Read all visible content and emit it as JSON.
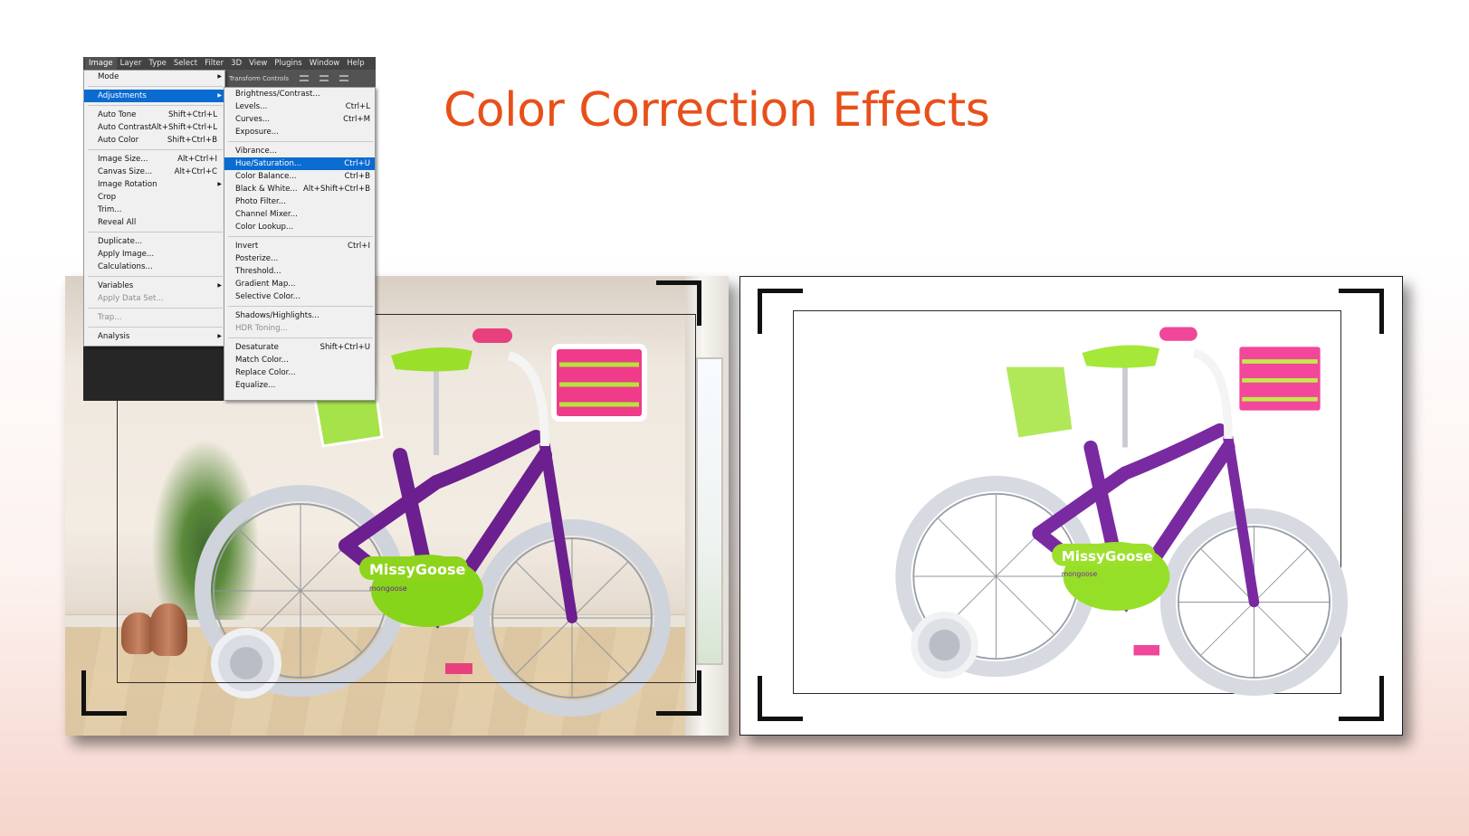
{
  "page": {
    "title": "Color Correction Effects",
    "accent_color": "#e8501a"
  },
  "photoshop": {
    "menubar": [
      "Image",
      "Layer",
      "Type",
      "Select",
      "Filter",
      "3D",
      "View",
      "Plugins",
      "Window",
      "Help"
    ],
    "active_menu": "Image",
    "options_bar_label": "Transform Controls",
    "image_menu": {
      "mode": {
        "label": "Mode",
        "submenu": true
      },
      "adjustments": {
        "label": "Adjustments",
        "submenu": true,
        "highlighted": true
      },
      "auto_tone": {
        "label": "Auto Tone",
        "shortcut": "Shift+Ctrl+L"
      },
      "auto_contrast": {
        "label": "Auto Contrast",
        "shortcut": "Alt+Shift+Ctrl+L"
      },
      "auto_color": {
        "label": "Auto Color",
        "shortcut": "Shift+Ctrl+B"
      },
      "image_size": {
        "label": "Image Size...",
        "shortcut": "Alt+Ctrl+I"
      },
      "canvas_size": {
        "label": "Canvas Size...",
        "shortcut": "Alt+Ctrl+C"
      },
      "image_rotation": {
        "label": "Image Rotation",
        "submenu": true
      },
      "crop": {
        "label": "Crop"
      },
      "trim": {
        "label": "Trim..."
      },
      "reveal_all": {
        "label": "Reveal All"
      },
      "duplicate": {
        "label": "Duplicate..."
      },
      "apply_image": {
        "label": "Apply Image..."
      },
      "calculations": {
        "label": "Calculations..."
      },
      "variables": {
        "label": "Variables",
        "submenu": true
      },
      "apply_data_set": {
        "label": "Apply Data Set...",
        "disabled": true
      },
      "trap": {
        "label": "Trap...",
        "disabled": true
      },
      "analysis": {
        "label": "Analysis",
        "submenu": true
      }
    },
    "adjustments_menu": {
      "brightness_contrast": {
        "label": "Brightness/Contrast..."
      },
      "levels": {
        "label": "Levels...",
        "shortcut": "Ctrl+L"
      },
      "curves": {
        "label": "Curves...",
        "shortcut": "Ctrl+M"
      },
      "exposure": {
        "label": "Exposure..."
      },
      "vibrance": {
        "label": "Vibrance..."
      },
      "hue_saturation": {
        "label": "Hue/Saturation...",
        "shortcut": "Ctrl+U",
        "highlighted": true
      },
      "color_balance": {
        "label": "Color Balance...",
        "shortcut": "Ctrl+B"
      },
      "black_white": {
        "label": "Black & White...",
        "shortcut": "Alt+Shift+Ctrl+B"
      },
      "photo_filter": {
        "label": "Photo Filter..."
      },
      "channel_mixer": {
        "label": "Channel Mixer..."
      },
      "color_lookup": {
        "label": "Color Lookup..."
      },
      "invert": {
        "label": "Invert",
        "shortcut": "Ctrl+I"
      },
      "posterize": {
        "label": "Posterize..."
      },
      "threshold": {
        "label": "Threshold..."
      },
      "gradient_map": {
        "label": "Gradient Map..."
      },
      "selective_color": {
        "label": "Selective Color..."
      },
      "shadows_highlights": {
        "label": "Shadows/Highlights..."
      },
      "hdr_toning": {
        "label": "HDR Toning...",
        "disabled": true
      },
      "desaturate": {
        "label": "Desaturate",
        "shortcut": "Shift+Ctrl+U"
      },
      "match_color": {
        "label": "Match Color..."
      },
      "replace_color": {
        "label": "Replace Color..."
      },
      "equalize": {
        "label": "Equalize..."
      }
    }
  },
  "images": {
    "before": {
      "description": "Purple Mongoose MissyGoose kids bike in sunlit room with plant and window",
      "brand_text": "MissyGoose",
      "sub_brand": "mongoose"
    },
    "after": {
      "description": "Same bike isolated on white background",
      "brand_text": "MissyGoose",
      "sub_brand": "mongoose"
    }
  }
}
